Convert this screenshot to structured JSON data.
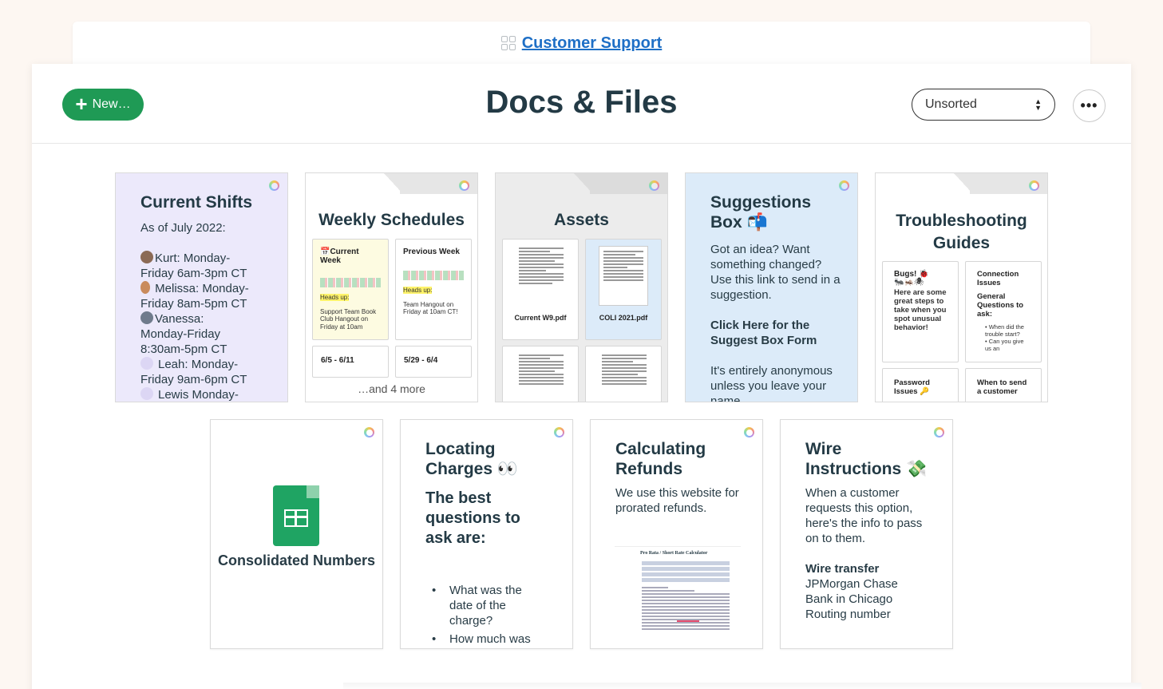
{
  "project": {
    "name": "Customer Support",
    "icon": "grid-icon"
  },
  "header": {
    "new_label": "New…",
    "title": "Docs & Files",
    "sort_value": "Unsorted",
    "more_icon": "ellipsis-icon"
  },
  "colors": {
    "accent_green": "#1f9a55",
    "link_blue": "#1e6fc6",
    "title_dark": "#233a45",
    "lavender": "#ece9fb",
    "light_blue": "#dcebf9"
  },
  "cards": {
    "current_shifts": {
      "title": "Current Shifts",
      "as_of": "As of July 2022:",
      "lines": [
        "Kurt: Monday-",
        "Friday 6am-3pm CT",
        " Melissa: Monday-",
        "Friday 8am-5pm CT",
        "Vanessa:",
        "Monday-Friday",
        "8:30am-5pm CT",
        "Leah: Monday-",
        "Friday 9am-6pm CT",
        "Lewis Monday-"
      ]
    },
    "weekly_schedules": {
      "title": "Weekly Schedules",
      "docs": [
        {
          "title": "Current Week",
          "heads_up": "Heads up:",
          "note": "Support Team Book Club Hangout on Friday at 10am"
        },
        {
          "title": "Previous Week",
          "heads_up": "Heads up:",
          "note": "Team Hangout on Friday at 10am CT!"
        },
        {
          "title": "6/5 - 6/11"
        },
        {
          "title": "5/29 - 6/4"
        }
      ],
      "more": "…and 4 more"
    },
    "assets": {
      "title": "Assets",
      "files": [
        {
          "name": "Current W9.pdf"
        },
        {
          "name": "COLI 2021.pdf"
        }
      ]
    },
    "suggestions": {
      "title": "Suggestions Box 📬",
      "body": "Got an idea? Want something changed? Use this link to send in a suggestion.",
      "link": "Click Here for the Suggest Box Form",
      "footer": "It's entirely anonymous unless you leave your name"
    },
    "troubleshooting": {
      "title": "Troubleshooting Guides",
      "docs": [
        {
          "title": "Bugs! 🐞",
          "body": "Here are some great steps to take when you spot unusual behavior!"
        },
        {
          "title": "Connection Issues",
          "subtitle": "General Questions to ask:",
          "bullets": [
            "When did the trouble start?",
            "Can you give us an"
          ]
        },
        {
          "title": "Password Issues 🔑"
        },
        {
          "title": "When to send a customer"
        }
      ]
    },
    "consolidated": {
      "title": "Consolidated Numbers"
    },
    "locating_charges": {
      "title": "Locating Charges 👀",
      "subtitle": "The best questions to ask are:",
      "bullets": [
        "What was the date of the charge?",
        "How much was"
      ]
    },
    "refunds": {
      "title": "Calculating Refunds",
      "body": "We use this website for prorated refunds.",
      "calc_title": "Pro Rata / Short Rate Calculator"
    },
    "wire": {
      "title": "Wire Instructions 💸",
      "body": "When a customer requests this option, here's the info to pass on to them.",
      "sub": "Wire transfer",
      "lines": [
        "JPMorgan Chase",
        "Bank in Chicago",
        "Routing number"
      ]
    }
  }
}
